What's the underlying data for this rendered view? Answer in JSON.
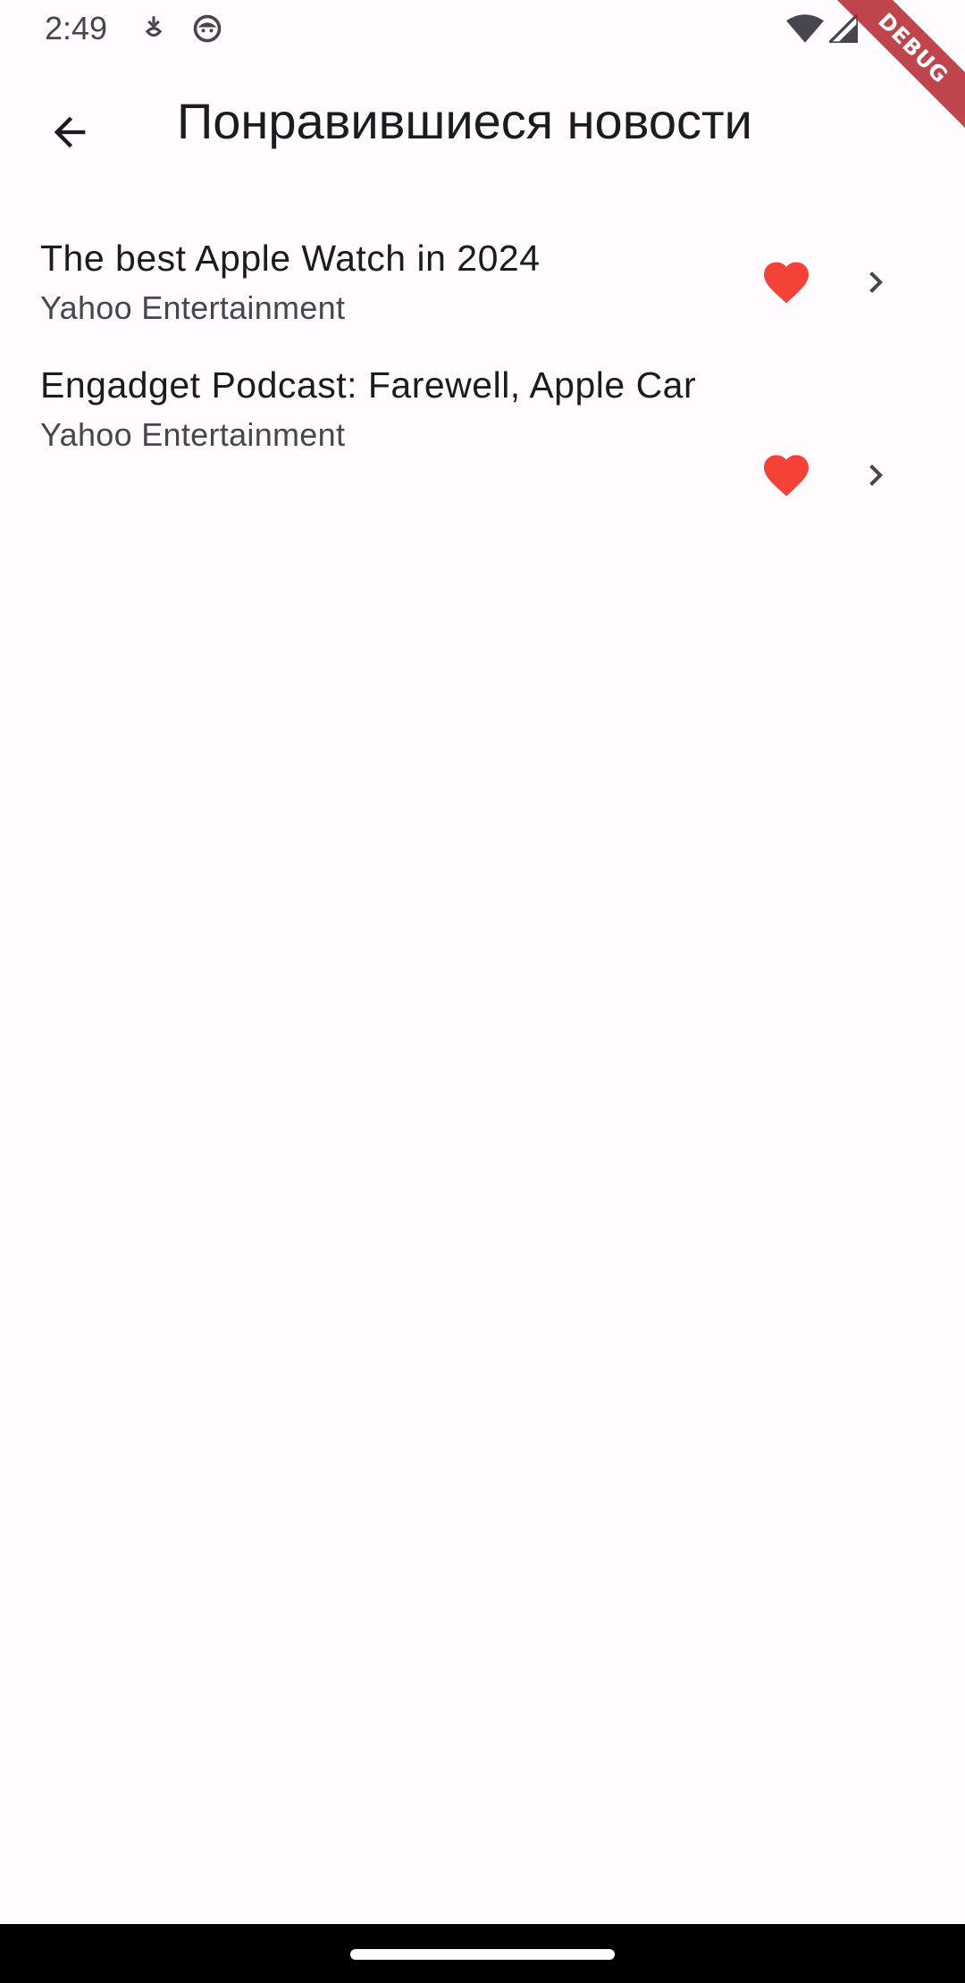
{
  "status_bar": {
    "time": "2:49"
  },
  "debug_banner": {
    "label": "DEBUG"
  },
  "app_bar": {
    "title": "Понравившиеся новости"
  },
  "news_items": [
    {
      "title": "The best Apple Watch in 2024",
      "source": "Yahoo Entertainment",
      "liked": true
    },
    {
      "title": "Engadget Podcast: Farewell, Apple Car",
      "source": "Yahoo Entertainment",
      "liked": true
    }
  ],
  "colors": {
    "background": "#fffbfe",
    "heart": "#f44336",
    "debug_banner": "#b3262d",
    "text_primary": "#1c1b1f",
    "text_secondary": "#49454f"
  },
  "icons": {
    "back": "arrow-back-icon",
    "like": "heart-icon",
    "open": "chevron-right-icon"
  }
}
